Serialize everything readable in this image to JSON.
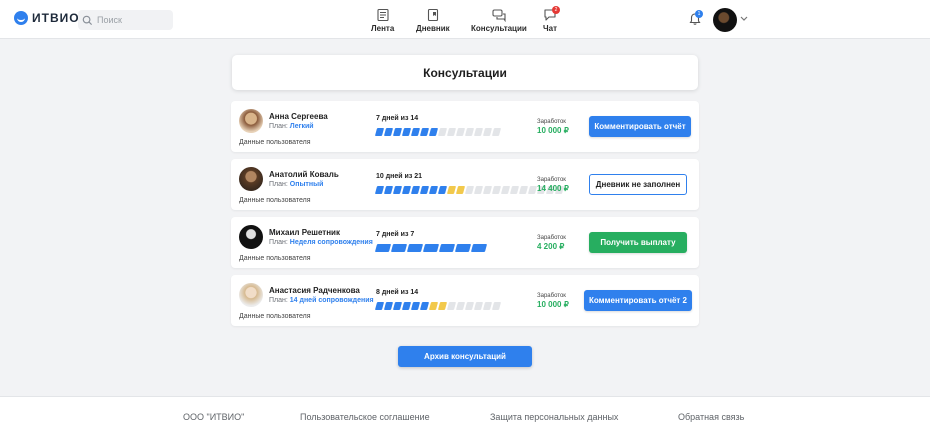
{
  "header": {
    "logo_text": "ИТВИО",
    "search_placeholder": "Поиск",
    "nav": [
      {
        "label": "Лента",
        "icon": "feed-icon"
      },
      {
        "label": "Дневник",
        "icon": "diary-icon"
      },
      {
        "label": "Консультации",
        "icon": "consultations-icon"
      },
      {
        "label": "Чат",
        "icon": "chat-icon",
        "badge": "2"
      }
    ],
    "notifications_badge": "1"
  },
  "page_title": "Консультации",
  "plan_prefix": "План:",
  "earn_label": "Заработок",
  "user_data_link": "Данные пользователя",
  "rows": [
    {
      "name": "Анна Сергеева",
      "plan": "Легкий",
      "progress_label": "7 дней из 14",
      "done": 7,
      "total": 14,
      "yellow_from": null,
      "earnings": "10 000 ₽",
      "action": "Комментировать отчёт",
      "action_style": "blue"
    },
    {
      "name": "Анатолий Коваль",
      "plan": "Опытный",
      "progress_label": "10 дней из 21",
      "done": 10,
      "total": 21,
      "yellow_from": 8,
      "earnings": "14 400 ₽",
      "action": "Дневник не заполнен",
      "action_style": "outline"
    },
    {
      "name": "Михаил Решетник",
      "plan": "Неделя сопровождения",
      "progress_label": "7 дней из 7",
      "done": 7,
      "total": 7,
      "yellow_from": null,
      "earnings": "4 200 ₽",
      "action": "Получить выплату",
      "action_style": "green"
    },
    {
      "name": "Анастасия Радченкова",
      "plan": "14 дней сопровождения",
      "progress_label": "8 дней из 14",
      "done": 8,
      "total": 14,
      "yellow_from": 6,
      "earnings": "10 000 ₽",
      "action": "Комментировать отчёт 2",
      "action_style": "blue"
    }
  ],
  "archive_button": "Архив консультаций",
  "footer": {
    "company": "ООО \"ИТВИО\"",
    "agreement": "Пользовательское соглашение",
    "privacy": "Защита персональных данных",
    "feedback": "Обратная связь"
  },
  "colors": {
    "accent": "#2f80ed",
    "success": "#27ae60",
    "warning": "#f2c94c",
    "badge": "#e53935"
  }
}
